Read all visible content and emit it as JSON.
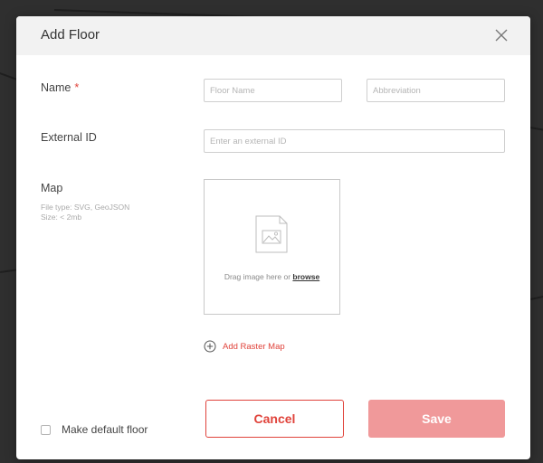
{
  "modal": {
    "title": "Add Floor",
    "close_icon": "close-icon"
  },
  "form": {
    "name_label": "Name",
    "required_marker": "*",
    "floor_name_placeholder": "Floor Name",
    "abbreviation_placeholder": "Abbreviation",
    "external_id_label": "External ID",
    "external_id_placeholder": "Enter an external ID",
    "map_label": "Map",
    "map_hint_line1": "File type: SVG, GeoJSON",
    "map_hint_line2": "Size: < 2mb",
    "dropzone_text": "Drag image here or",
    "browse_link": "browse",
    "dropzone_icon": "image-file-icon",
    "add_raster_icon": "plus-circle-icon",
    "add_raster_label": "Add Raster Map",
    "default_floor_label": "Make default floor",
    "default_floor_checked": false
  },
  "actions": {
    "cancel_label": "Cancel",
    "save_label": "Save"
  },
  "colors": {
    "accent": "#e0433b",
    "save_disabled": "#f0999a",
    "header_bg": "#f2f2f2"
  }
}
